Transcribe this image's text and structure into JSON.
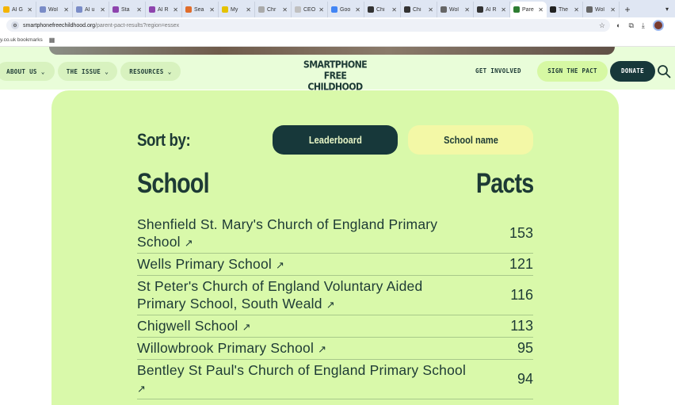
{
  "browser": {
    "tabs": [
      {
        "title": "AI G",
        "color": "#f4b400"
      },
      {
        "title": "Wol",
        "color": "#7a8cc7"
      },
      {
        "title": "AI u",
        "color": "#7a8cc7"
      },
      {
        "title": "Sta",
        "color": "#8e44ad"
      },
      {
        "title": "AI R",
        "color": "#8e44ad"
      },
      {
        "title": "Sea",
        "color": "#e06d2b"
      },
      {
        "title": "My",
        "color": "#e5c200"
      },
      {
        "title": "Chr",
        "color": "#aaaaaa"
      },
      {
        "title": "CEO",
        "color": "#c0c0c0"
      },
      {
        "title": "Goo",
        "color": "#4285f4"
      },
      {
        "title": "Chi",
        "color": "#333333"
      },
      {
        "title": "Chi",
        "color": "#333333"
      },
      {
        "title": "Wol",
        "color": "#666666"
      },
      {
        "title": "AI R",
        "color": "#333333"
      },
      {
        "title": "Pare",
        "color": "#2e7d32",
        "active": true
      },
      {
        "title": "The",
        "color": "#222222"
      },
      {
        "title": "Wol",
        "color": "#666666"
      }
    ],
    "url_host": "smartphonefreechildhood.org",
    "url_path": "/parent-pact-results?region=essex",
    "bookmark_label": "y.co.uk bookmarks"
  },
  "nav": {
    "about_label": "ABOUT US",
    "issue_label": "THE ISSUE",
    "resources_label": "RESOURCES",
    "logo_line1": "SMARTPHONE",
    "logo_line2": "FREE CHILDHOOD",
    "get_involved_label": "GET INVOLVED",
    "sign_pact_label": "SIGN THE PACT",
    "donate_label": "DONATE"
  },
  "results": {
    "sort_label": "Sort by:",
    "leaderboard_label": "Leaderboard",
    "school_name_label": "School name",
    "school_heading": "School",
    "pacts_heading": "Pacts",
    "arrow": "↗",
    "rows": [
      {
        "name": "Shenfield St. Mary's Church of England Primary School",
        "pacts": "153"
      },
      {
        "name": "Wells Primary School",
        "pacts": "121"
      },
      {
        "name": "St Peter's Church of England Voluntary Aided Primary School, South Weald",
        "pacts": "116"
      },
      {
        "name": "Chigwell School",
        "pacts": "113"
      },
      {
        "name": "Willowbrook Primary School",
        "pacts": "95"
      },
      {
        "name": "Bentley St Paul's Church of England Primary School",
        "pacts": "94"
      }
    ]
  }
}
